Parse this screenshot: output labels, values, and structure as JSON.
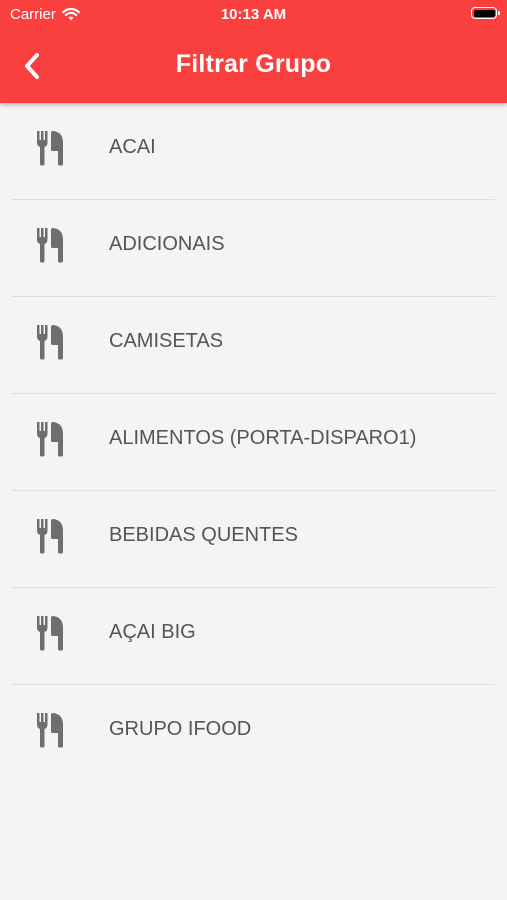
{
  "status_bar": {
    "carrier": "Carrier",
    "time": "10:13 AM"
  },
  "header": {
    "title": "Filtrar Grupo",
    "background_color": "#fa3f3f",
    "back_icon": "chevron-left-icon"
  },
  "groups": [
    {
      "label": "ACAI",
      "icon": "utensils-icon"
    },
    {
      "label": "ADICIONAIS",
      "icon": "utensils-icon"
    },
    {
      "label": "CAMISETAS",
      "icon": "utensils-icon"
    },
    {
      "label": "ALIMENTOS (PORTA-DISPARO1)",
      "icon": "utensils-icon"
    },
    {
      "label": "BEBIDAS QUENTES",
      "icon": "utensils-icon"
    },
    {
      "label": "AÇAI BIG",
      "icon": "utensils-icon"
    },
    {
      "label": "GRUPO IFOOD",
      "icon": "utensils-icon"
    }
  ]
}
